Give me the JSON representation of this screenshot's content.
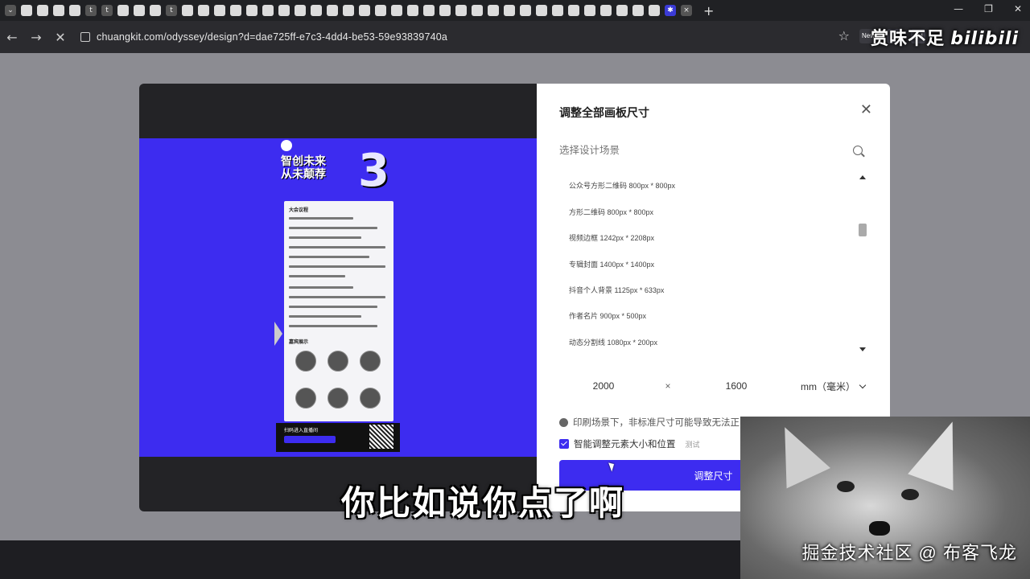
{
  "browser": {
    "url": "chuangkit.com/odyssey/design?d=dae725ff-e7c3-4dd4-be53-59e93839740a",
    "tab_icons": [
      "t",
      "t",
      "t"
    ],
    "ext_new_label": "New",
    "ext_jm_label": "JM"
  },
  "overlay": {
    "top_watermark": "赏味不足",
    "top_watermark_brand": "bilibili",
    "subtitle": "你比如说你点了啊",
    "bottom_watermark": "掘金技术社区 @ 布客飞龙"
  },
  "poster": {
    "title_line1": "智创未来",
    "title_line2": "从未颠荐",
    "number": "3",
    "section1": "大会议程",
    "section2": "嘉宾展示",
    "footer_text": "扫码进入直播间"
  },
  "dialog": {
    "title": "调整全部画板尺寸",
    "search_placeholder": "选择设计场景",
    "list_items": [
      "公众号方形二维码 800px * 800px",
      "方形二维码 800px * 800px",
      "视频边框 1242px * 2208px",
      "专辑封面 1400px * 1400px",
      "抖音个人背景 1125px * 633px",
      "作者名片 900px * 500px",
      "动态分割线 1080px * 200px"
    ],
    "width_value": "2000",
    "times": "×",
    "height_value": "1600",
    "unit": "mm（毫米）",
    "note": "印刷场景下，非标准尺寸可能导致无法正",
    "checkbox_label": "智能调整元素大小和位置",
    "beta_label": "测试",
    "primary_button": "调整尺寸"
  }
}
